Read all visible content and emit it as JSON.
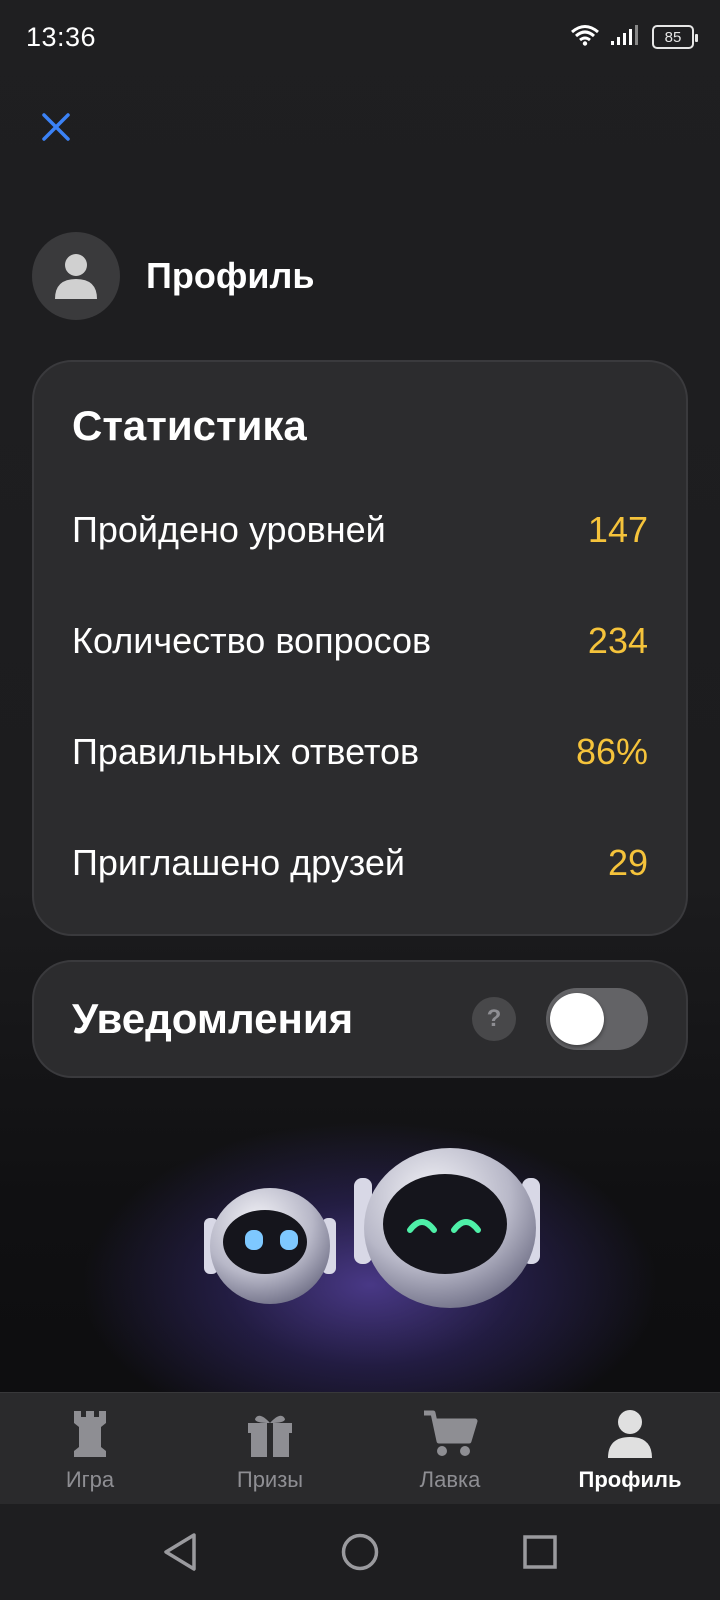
{
  "status_bar": {
    "time": "13:36",
    "battery": "85"
  },
  "profile": {
    "title": "Профиль"
  },
  "stats": {
    "title": "Статистика",
    "rows": [
      {
        "label": "Пройдено уровней",
        "value": "147"
      },
      {
        "label": "Количество вопросов",
        "value": "234"
      },
      {
        "label": "Правильных ответов",
        "value": "86%"
      },
      {
        "label": "Приглашено друзей",
        "value": "29"
      }
    ]
  },
  "notifications": {
    "title": "Уведомления",
    "help_label": "?",
    "enabled": false
  },
  "bottom_nav": {
    "items": [
      {
        "label": "Игра",
        "icon": "rook-icon"
      },
      {
        "label": "Призы",
        "icon": "gift-icon"
      },
      {
        "label": "Лавка",
        "icon": "cart-icon"
      },
      {
        "label": "Профиль",
        "icon": "person-icon"
      }
    ],
    "active_index": 3
  },
  "colors": {
    "accent_value": "#f5c33b",
    "close_icon": "#3b82f6",
    "card_bg": "#2c2c2e"
  }
}
